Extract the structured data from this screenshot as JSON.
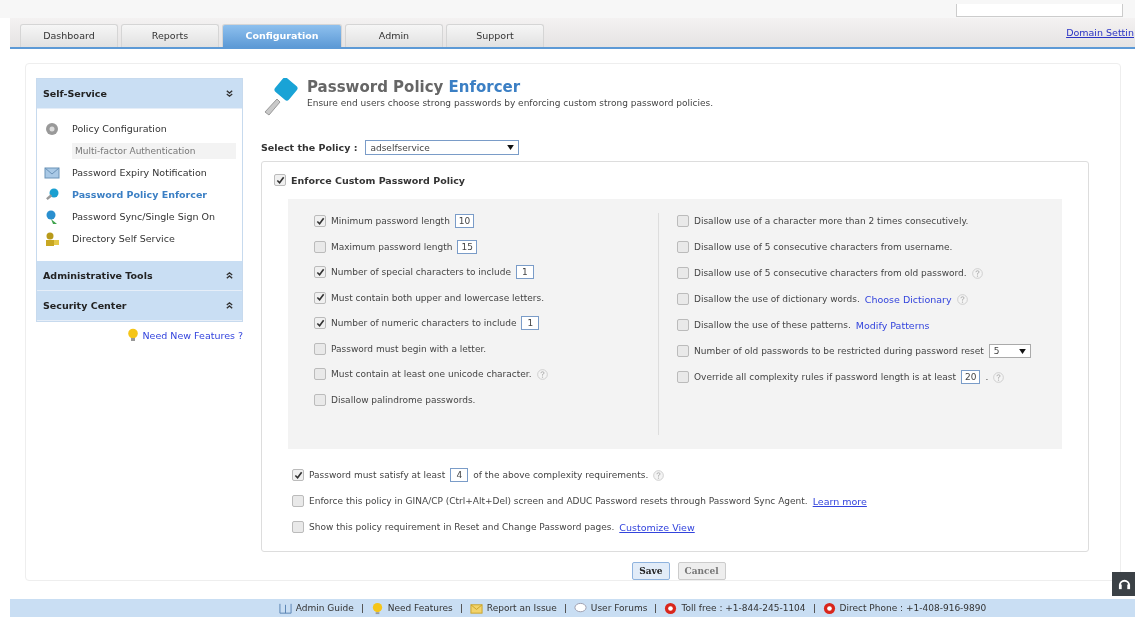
{
  "tabs": [
    {
      "label": "Dashboard",
      "selected": false
    },
    {
      "label": "Reports",
      "selected": false
    },
    {
      "label": "Configuration",
      "selected": true
    },
    {
      "label": "Admin",
      "selected": false
    },
    {
      "label": "Support",
      "selected": false
    }
  ],
  "header_link": "Domain Settin",
  "sidebar": {
    "sections": [
      {
        "title": "Self-Service",
        "expanded": true,
        "items": [
          {
            "label": "Policy Configuration",
            "selected": false,
            "sub_items": [
              "Multi-factor Authentication"
            ]
          },
          {
            "label": "Password Expiry Notification",
            "selected": false
          },
          {
            "label": "Password Policy Enforcer",
            "selected": true
          },
          {
            "label": "Password Sync/Single Sign On",
            "selected": false
          },
          {
            "label": "Directory Self Service",
            "selected": false
          }
        ]
      },
      {
        "title": "Administrative Tools",
        "expanded": false
      },
      {
        "title": "Security Center",
        "expanded": false
      }
    ],
    "link": "Need New Features ?"
  },
  "page": {
    "title": "Password Policy",
    "title_accent": "Enforcer",
    "subtitle": "Ensure end users choose strong passwords by enforcing custom strong password policies."
  },
  "policy_select": {
    "label": "Select the Policy :",
    "value": "adselfservice"
  },
  "enforce": {
    "label": "Enforce Custom Password Policy",
    "checked": true
  },
  "rules_left": [
    {
      "checked": true,
      "label": "Minimum password length",
      "field": {
        "kind": "text",
        "value": "10"
      }
    },
    {
      "checked": false,
      "label": "Maximum password length",
      "field": {
        "kind": "text",
        "value": "15"
      }
    },
    {
      "checked": true,
      "label": "Number of special characters to include",
      "field": {
        "kind": "text",
        "value": "1"
      }
    },
    {
      "checked": true,
      "label": "Must contain both upper and lowercase letters."
    },
    {
      "checked": true,
      "label": "Number of numeric characters to include",
      "field": {
        "kind": "text",
        "value": "1"
      }
    },
    {
      "checked": false,
      "label": "Password must begin with a letter."
    },
    {
      "checked": false,
      "label": "Must contain at least one unicode character.",
      "help": true
    },
    {
      "checked": false,
      "label": "Disallow palindrome passwords."
    }
  ],
  "rules_right": [
    {
      "checked": false,
      "label": "Disallow use of a character more than 2 times consecutively."
    },
    {
      "checked": false,
      "label": "Disallow use of 5 consecutive characters from username."
    },
    {
      "checked": false,
      "label": "Disallow use of 5 consecutive characters from old password.",
      "help": true
    },
    {
      "checked": false,
      "label": "Disallow the use of dictionary words.",
      "link": "Choose Dictionary",
      "help": true
    },
    {
      "checked": false,
      "label": "Disallow the use of these patterns.",
      "link": "Modify Patterns"
    },
    {
      "checked": false,
      "label": "Number of old passwords to be restricted during password reset",
      "field": {
        "kind": "select",
        "value": "5"
      }
    },
    {
      "checked": false,
      "label": "Override all complexity rules if password length is at least",
      "field": {
        "kind": "text",
        "value": "20"
      },
      "suffix": ".",
      "help": true
    }
  ],
  "options": [
    {
      "checked": true,
      "label": "Password must satisfy at least",
      "field": {
        "kind": "text",
        "value": "4"
      },
      "suffix": "of the above complexity requirements.",
      "help": true
    },
    {
      "checked": false,
      "label": "Enforce this policy in GINA/CP (Ctrl+Alt+Del) screen and ADUC Password resets through Password Sync Agent.",
      "link": "Learn more",
      "underline": true
    },
    {
      "checked": false,
      "label": "Show this policy requirement in Reset and Change Password pages.",
      "link": "Customize View",
      "underline": true
    }
  ],
  "buttons": [
    {
      "label": "Save",
      "primary": true
    },
    {
      "label": "Cancel",
      "primary": false
    }
  ],
  "footer": [
    "Admin Guide",
    "Need Features",
    "Report an Issue",
    "User Forums",
    "Toll free : +1-844-245-1104",
    "Direct Phone : +1-408-916-9890"
  ]
}
